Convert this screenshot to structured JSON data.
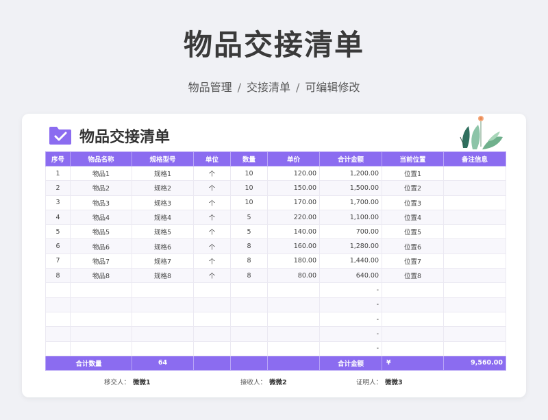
{
  "page": {
    "title": "物品交接清单",
    "breadcrumb": [
      "物品管理",
      "交接清单",
      "可编辑修改"
    ],
    "separator": "/"
  },
  "card": {
    "title": "物品交接清单",
    "icon": "folder-check-icon",
    "decoration": "plant-leaves-icon"
  },
  "table": {
    "headers": [
      "序号",
      "物品名称",
      "规格型号",
      "单位",
      "数量",
      "单价",
      "合计金额",
      "当前位置",
      "备注信息"
    ],
    "rows": [
      [
        "1",
        "物品1",
        "规格1",
        "个",
        "10",
        "120.00",
        "1,200.00",
        "位置1",
        ""
      ],
      [
        "2",
        "物品2",
        "规格2",
        "个",
        "10",
        "150.00",
        "1,500.00",
        "位置2",
        ""
      ],
      [
        "3",
        "物品3",
        "规格3",
        "个",
        "10",
        "170.00",
        "1,700.00",
        "位置3",
        ""
      ],
      [
        "4",
        "物品4",
        "规格4",
        "个",
        "5",
        "220.00",
        "1,100.00",
        "位置4",
        ""
      ],
      [
        "5",
        "物品5",
        "规格5",
        "个",
        "5",
        "140.00",
        "700.00",
        "位置5",
        ""
      ],
      [
        "6",
        "物品6",
        "规格6",
        "个",
        "8",
        "160.00",
        "1,280.00",
        "位置6",
        ""
      ],
      [
        "7",
        "物品7",
        "规格7",
        "个",
        "8",
        "180.00",
        "1,440.00",
        "位置7",
        ""
      ],
      [
        "8",
        "物品8",
        "规格8",
        "个",
        "8",
        "80.00",
        "640.00",
        "位置8",
        ""
      ],
      [
        "",
        "",
        "",
        "",
        "",
        "",
        "-",
        "",
        ""
      ],
      [
        "",
        "",
        "",
        "",
        "",
        "",
        "-",
        "",
        ""
      ],
      [
        "",
        "",
        "",
        "",
        "",
        "",
        "-",
        "",
        ""
      ],
      [
        "",
        "",
        "",
        "",
        "",
        "",
        "-",
        "",
        ""
      ],
      [
        "",
        "",
        "",
        "",
        "",
        "",
        "-",
        "",
        ""
      ]
    ],
    "total": {
      "qty_label": "合计数量",
      "qty_value": "64",
      "amount_label": "合计金额",
      "currency": "¥",
      "amount_value": "9,560.00"
    }
  },
  "signatures": {
    "handover_label": "移交人：",
    "handover_name": "微微1",
    "receiver_label": "接收人：",
    "receiver_name": "微微2",
    "witness_label": "证明人：",
    "witness_name": "微微3"
  },
  "colors": {
    "accent": "#8b6cf0",
    "background": "#f0f1f5",
    "row_alt": "#f8f7fc"
  }
}
